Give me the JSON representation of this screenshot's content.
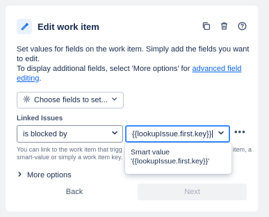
{
  "header": {
    "title": "Edit work item",
    "icons": [
      "edit-icon",
      "copy-icon",
      "trash-icon",
      "help-icon"
    ]
  },
  "description": {
    "line1": "Set values for fields on the work item. Simply add the fields you want to edit.",
    "line2_prefix": "To display additional fields, select 'More options' for ",
    "line2_link": "advanced field editing",
    "line2_suffix": "."
  },
  "choose_fields": {
    "label": "Choose fields to set...",
    "icons": [
      "gear-icon",
      "chevron-down-icon"
    ]
  },
  "linked_issues": {
    "label": "Linked Issues",
    "relation_value": "is blocked by",
    "issue_value": "{{lookupIssue.first.key}}",
    "more_actions": "•••",
    "helper_left": "You can link to the work item that trigg",
    "helper_right": "item, a",
    "helper_line2_left": "smart-value or simply a work item key."
  },
  "dropdown": {
    "option_line1": "Smart value",
    "option_line2": "'{{lookupIssue.first.key}}'"
  },
  "more_options": {
    "label": "More options"
  },
  "footer": {
    "back_label": "Back",
    "next_label": "Next"
  },
  "colors": {
    "accent": "#0c66e4",
    "focus_border": "#388bff",
    "disabled_bg": "#f1f2f4"
  }
}
